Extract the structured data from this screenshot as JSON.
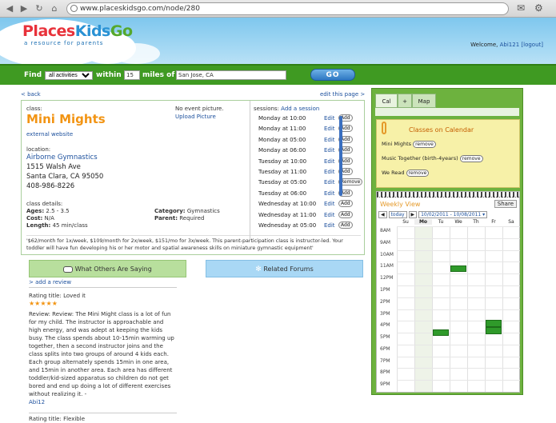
{
  "browser": {
    "url": "www.placeskidsgo.com/node/280"
  },
  "brand": {
    "name_a": "Places",
    "name_b": "Kids",
    "name_c": "Go",
    "tagline": "a resource for parents"
  },
  "welcome": {
    "text": "Welcome,",
    "user": "Abi121",
    "logout": "[logout]"
  },
  "find": {
    "label": "Find",
    "activity": "all activities",
    "within": "within",
    "miles_value": "15",
    "miles_label": "miles of",
    "location": "San Jose, CA",
    "go": "GO"
  },
  "nav": {
    "back": "< back",
    "edit": "edit this page >"
  },
  "klass": {
    "label": "class:",
    "title": "Mini Mights",
    "external": "external website",
    "no_picture": "No event picture.",
    "upload": "Upload Picture",
    "location_label": "location:",
    "venue": "Airborne Gymnastics",
    "street": "1515 Walsh Ave",
    "city": "Santa Clara, CA 95050",
    "phone": "408-986-8226",
    "details_label": "class details:",
    "ages_k": "Ages:",
    "ages_v": "2.5 - 3.5",
    "cost_k": "Cost:",
    "cost_v": "N/A",
    "length_k": "Length:",
    "length_v": "45 min/class",
    "category_k": "Category:",
    "category_v": "Gymnastics",
    "parent_k": "Parent:",
    "parent_v": "Required",
    "description": "'$62/month for 1x/week, $109/month for 2x/week, $151/mo for 3x/week. This parent-participation class is instructor-led. Your toddler will have fun developing his or her motor and spatial awareness skills on miniature gymnastic equipment'"
  },
  "sessions": {
    "label": "sessions:",
    "add": "Add a session",
    "edit": "Edit",
    "rows": [
      {
        "time": "Monday at 10:00",
        "btn": "Add"
      },
      {
        "time": "Monday at 11:00",
        "btn": "Add"
      },
      {
        "time": "Monday at 05:00",
        "btn": "Add"
      },
      {
        "time": "Monday at 06:00",
        "btn": "Add"
      },
      {
        "time": "Tuesday at 10:00",
        "btn": "Add"
      },
      {
        "time": "Tuesday at 11:00",
        "btn": "Add"
      },
      {
        "time": "Tuesday at 05:00",
        "btn": "Remove"
      },
      {
        "time": "Tuesday at 06:00",
        "btn": "Add"
      },
      {
        "time": "Wednesday at 10:00",
        "btn": "Add"
      },
      {
        "time": "Wednesday at 11:00",
        "btn": "Add"
      },
      {
        "time": "Wednesday at 05:00",
        "btn": "Add"
      }
    ]
  },
  "others": {
    "title": "What Others Are Saying",
    "add_review": "> add a review",
    "rating_title": "Rating title: Loved it",
    "stars": "★★★★★",
    "review": "Review: Review: The Mini Might class is a lot of fun for my child. The instructor is approachable and high energy, and was adept at keeping the kids busy. The class spends about 10-15min warming up together, then a second instructor joins and the class splits into two groups of around 4 kids each. Each group alternately spends 15min in one area, and 15min in another area. Each area has different toddler/kid-sized apparatus so children do not get bored and end up doing a lot of different exercises without realizing it. -",
    "author": "Abi12",
    "next_title": "Rating title: Flexible"
  },
  "forums": {
    "title": "Related Forums"
  },
  "sidebar": {
    "tabs": [
      "Cal",
      "+",
      "Map"
    ],
    "cal_title": "Classes on Calendar",
    "classes": [
      {
        "name": "Mini Mights",
        "btn": "remove"
      },
      {
        "name": "Music Together (birth-4years)",
        "btn": "remove"
      },
      {
        "name": "We Read",
        "btn": "remove"
      }
    ],
    "weekly": "Weekly View",
    "share": "Share",
    "today": "today",
    "range": "10/02/2011 - 10/08/2011",
    "days": [
      "Su",
      "Mo",
      "Tu",
      "We",
      "Th",
      "Fr",
      "Sa"
    ],
    "hours": [
      "8AM",
      "9AM",
      "10AM",
      "11AM",
      "12PM",
      "1PM",
      "2PM",
      "3PM",
      "4PM",
      "5PM",
      "6PM",
      "7PM",
      "8PM",
      "9PM"
    ]
  }
}
